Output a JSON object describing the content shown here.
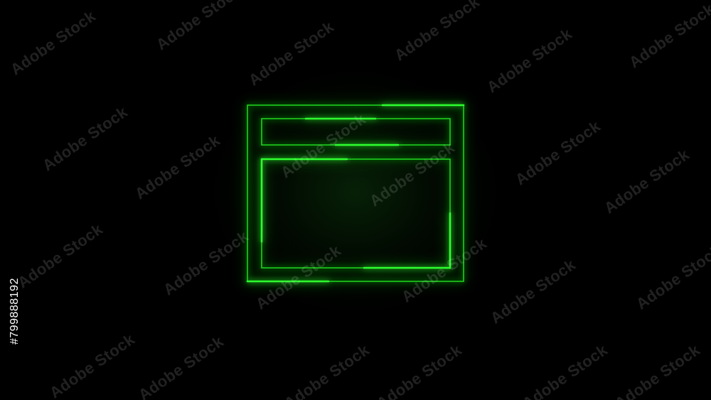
{
  "watermark": {
    "text": "Adobe Stock"
  },
  "stock_id": "#799888192",
  "icon": {
    "name": "browser-window-icon",
    "color": "#2fff2f",
    "glow_color": "#1ecf1e"
  },
  "background_color": "#000000"
}
